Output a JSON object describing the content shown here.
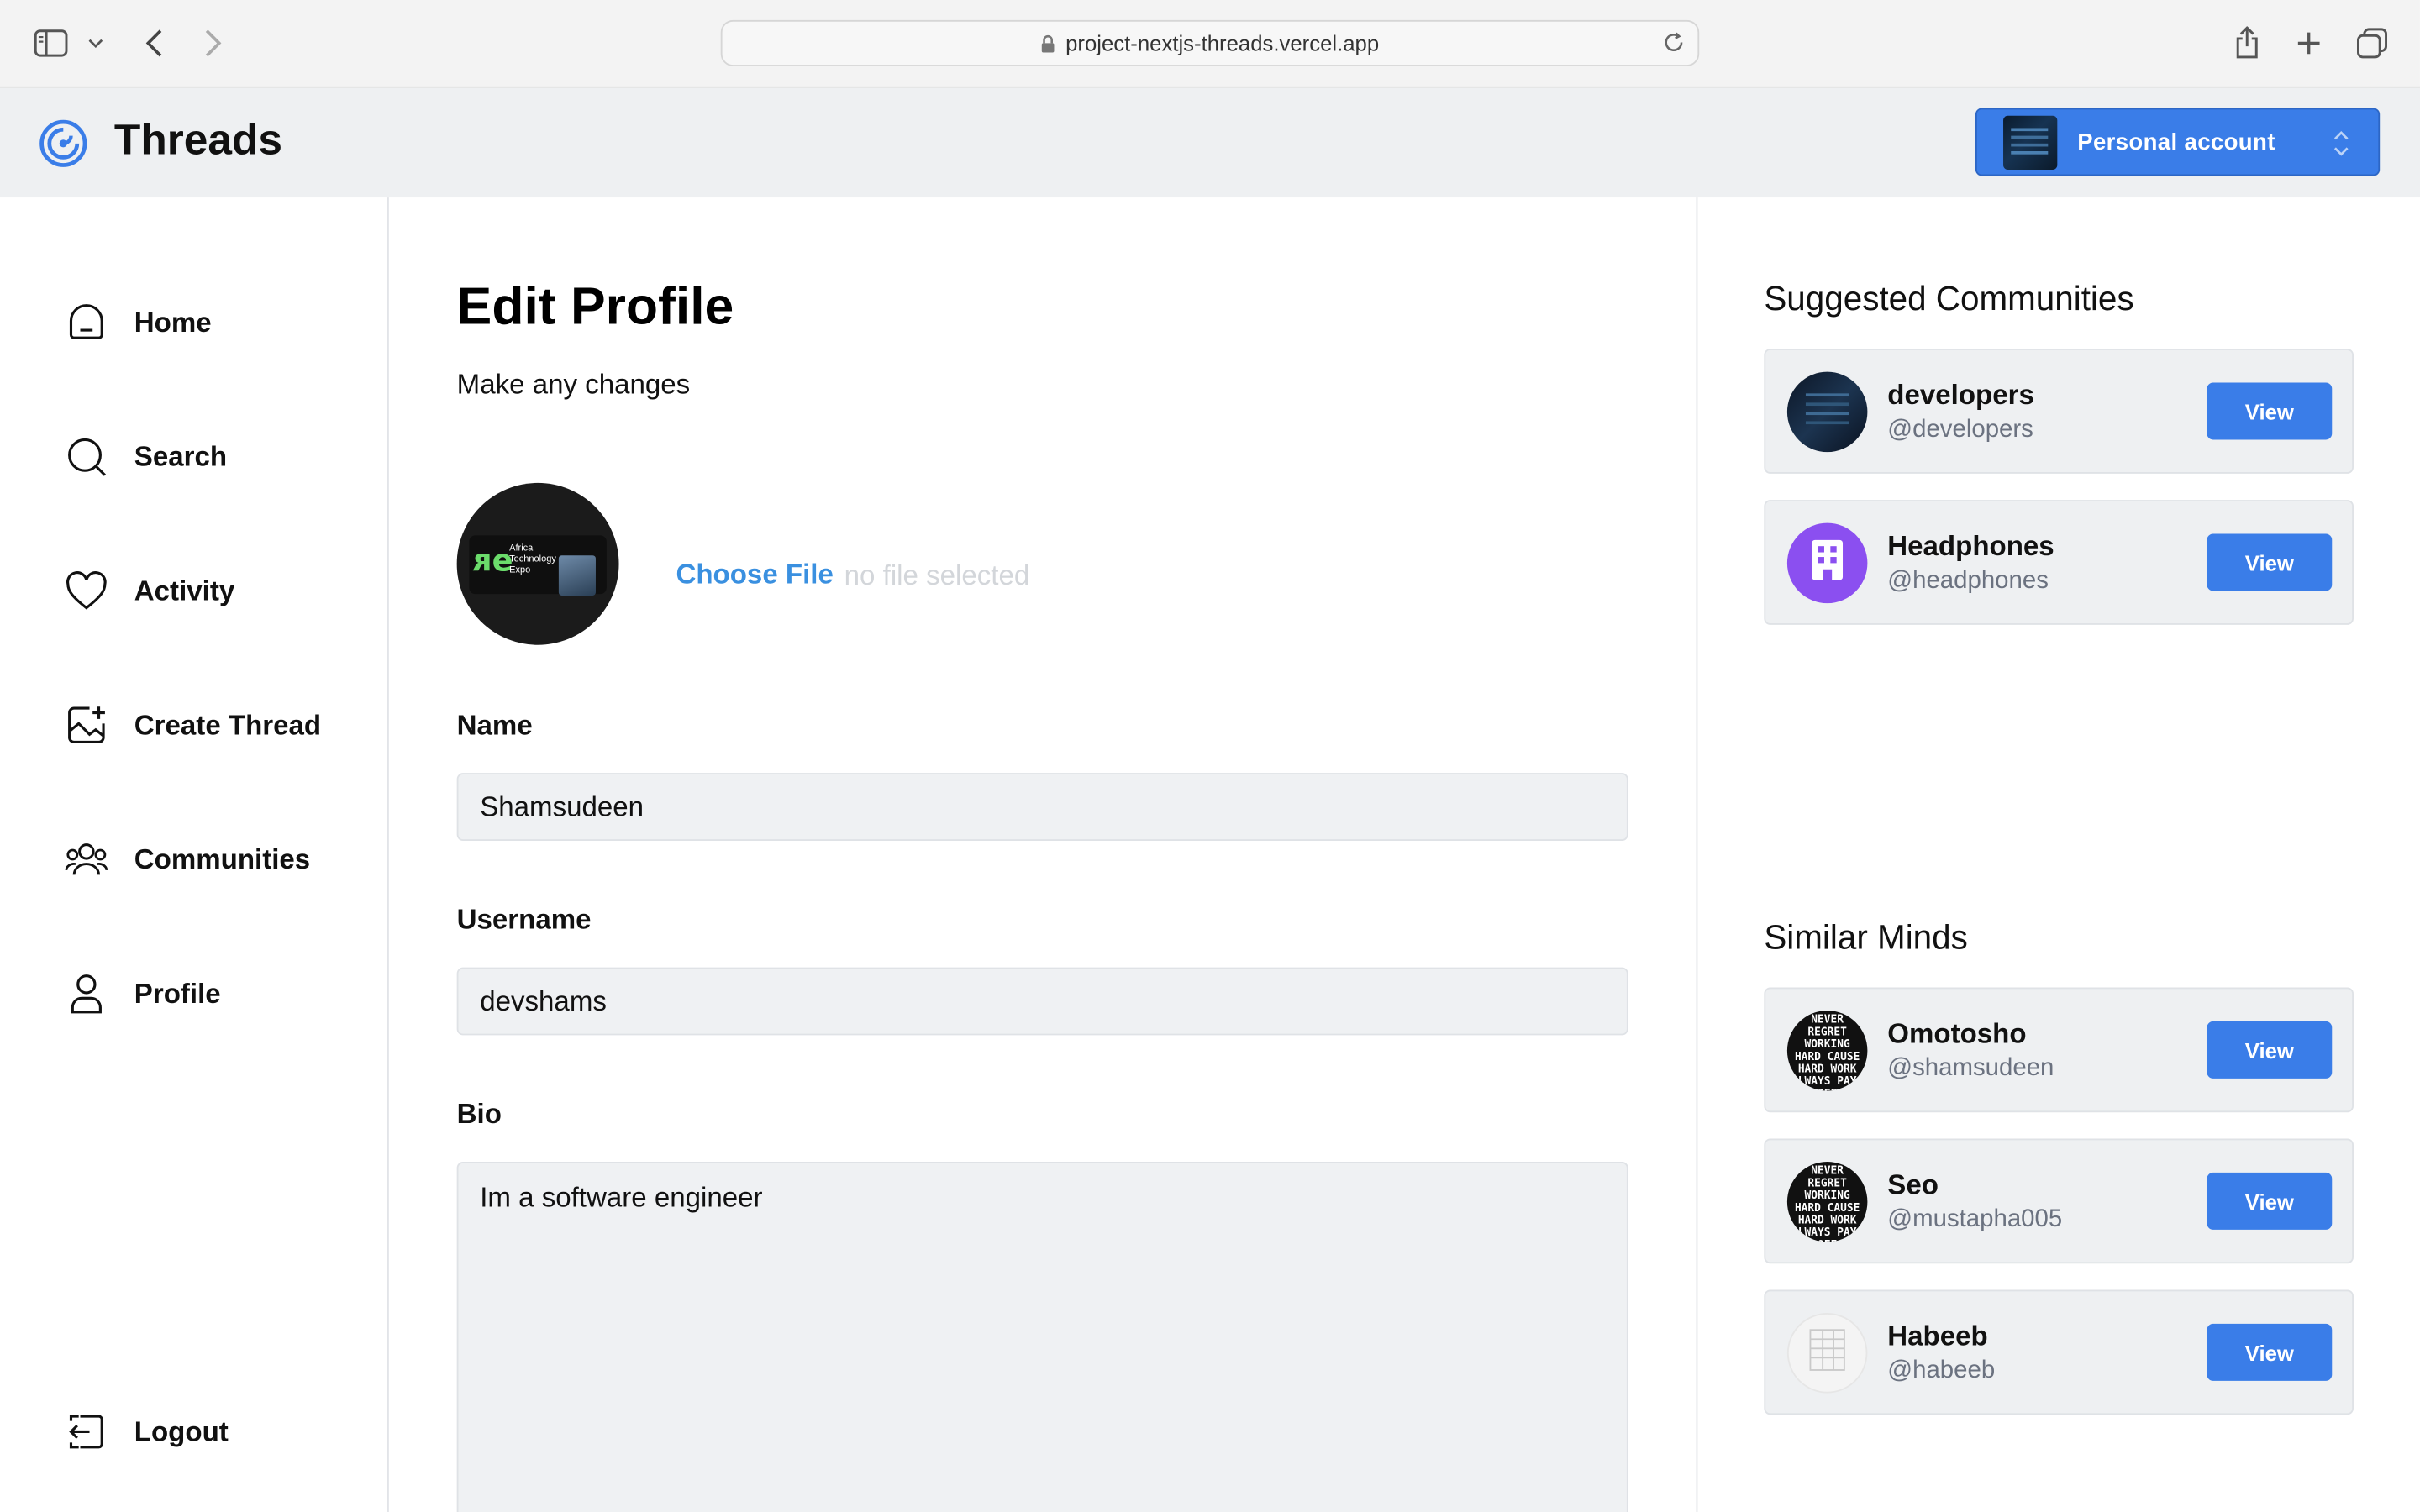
{
  "browser": {
    "url": "project-nextjs-threads.vercel.app"
  },
  "app": {
    "brand": "Threads",
    "account_label": "Personal account"
  },
  "nav": {
    "items": [
      {
        "label": "Home",
        "icon": "home-icon"
      },
      {
        "label": "Search",
        "icon": "search-icon"
      },
      {
        "label": "Activity",
        "icon": "heart-icon"
      },
      {
        "label": "Create Thread",
        "icon": "create-icon"
      },
      {
        "label": "Communities",
        "icon": "users-icon"
      },
      {
        "label": "Profile",
        "icon": "user-icon"
      }
    ],
    "logout": "Logout"
  },
  "profile_form": {
    "title": "Edit Profile",
    "subtitle": "Make any changes",
    "choose_file": "Choose File",
    "no_file": "no file selected",
    "avatar_text": "Africa Technology Expo",
    "name_label": "Name",
    "name_value": "Shamsudeen",
    "username_label": "Username",
    "username_value": "devshams",
    "bio_label": "Bio",
    "bio_value": "Im a software engineer"
  },
  "suggested": {
    "title": "Suggested Communities",
    "items": [
      {
        "name": "developers",
        "handle": "@developers",
        "button": "View"
      },
      {
        "name": "Headphones",
        "handle": "@headphones",
        "button": "View"
      }
    ]
  },
  "similar": {
    "title": "Similar Minds",
    "items": [
      {
        "name": "Omotosho",
        "handle": "@shamsudeen",
        "button": "View"
      },
      {
        "name": "Seo",
        "handle": "@mustapha005",
        "button": "View"
      },
      {
        "name": "Habeeb",
        "handle": "@habeeb",
        "button": "View"
      }
    ]
  },
  "quote_avatar_text": "YOU WILL NEVER REGRET WORKING HARD CAUSE HARD WORK ALWAYS PAYS OFF"
}
